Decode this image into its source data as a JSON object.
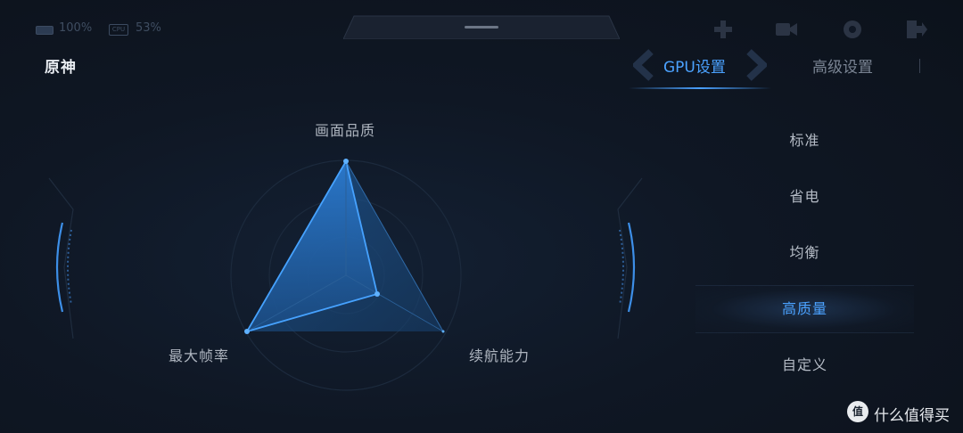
{
  "status_bar": {
    "battery": "100%",
    "cpu_badge": "CPU",
    "cpu_usage": "53%",
    "icons": [
      "crosshair-icon",
      "video-record-icon",
      "settings-gear-icon",
      "exit-icon"
    ]
  },
  "header": {
    "game_title": "原神",
    "tabs": [
      {
        "label": "GPU设置",
        "active": true
      },
      {
        "label": "高级设置",
        "active": false
      }
    ]
  },
  "radar": {
    "axes": [
      "画面品质",
      "续航能力",
      "最大帧率"
    ],
    "values": {
      "画面品质": 1.0,
      "续航能力": 0.18,
      "最大帧率": 1.0
    },
    "accent_color": "#3d9bff"
  },
  "modes": {
    "items": [
      "标准",
      "省电",
      "均衡",
      "高质量",
      "自定义"
    ],
    "selected": "高质量"
  },
  "watermark": {
    "logo": "值",
    "text": "什么值得买"
  },
  "colors": {
    "background": "#0e1520",
    "accent": "#4ba2ff",
    "text_muted": "#7a8493"
  }
}
